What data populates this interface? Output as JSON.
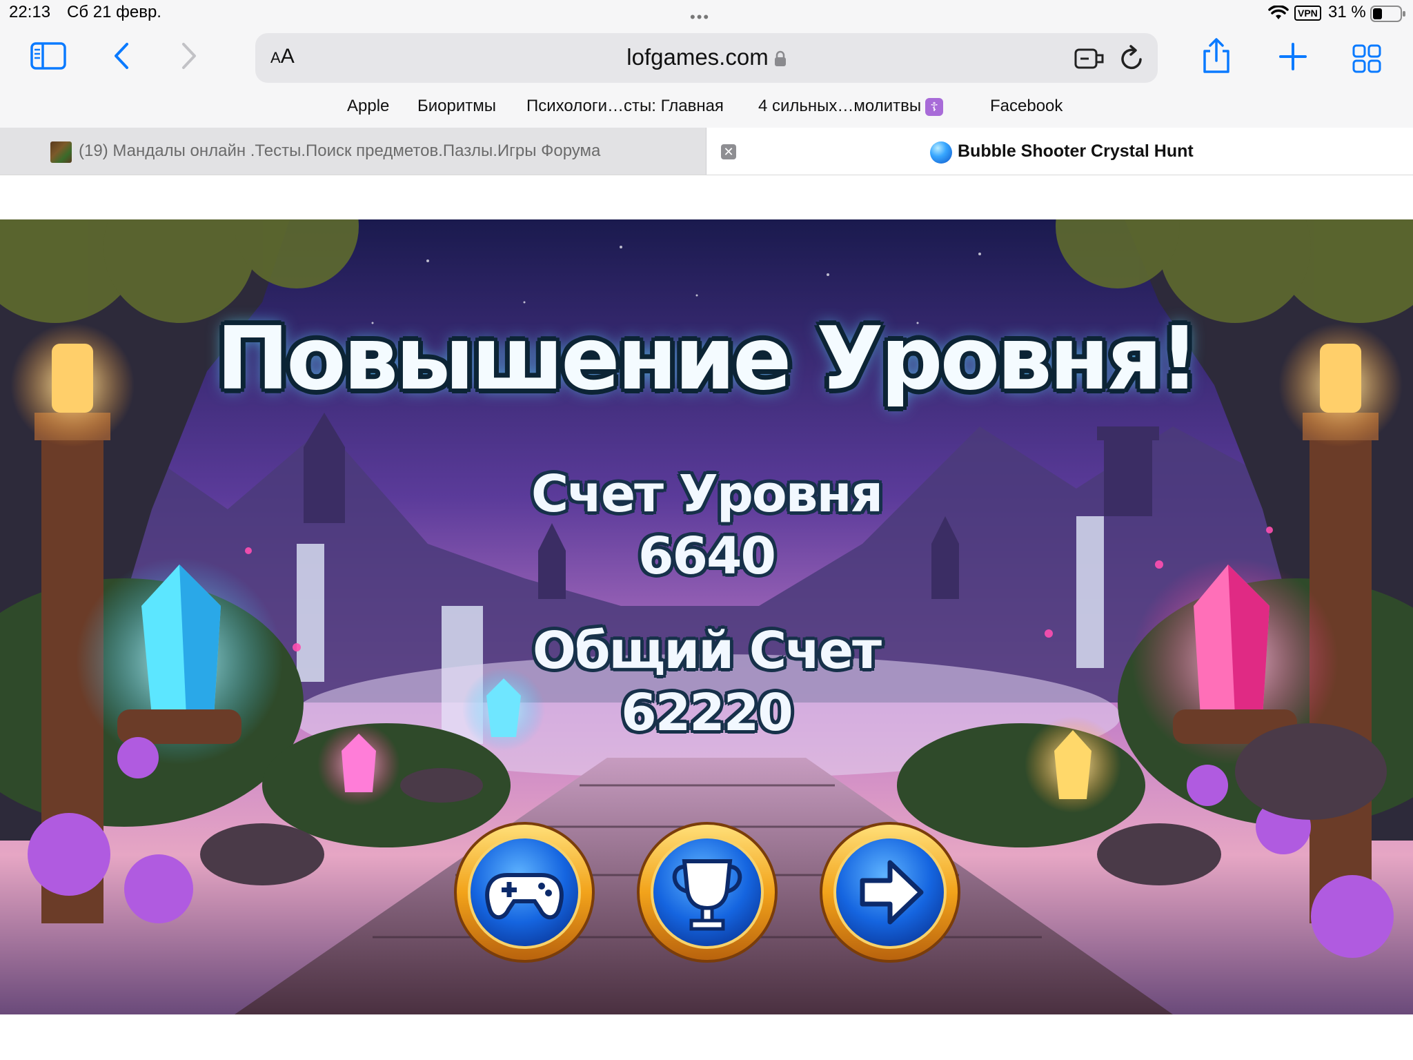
{
  "status_bar": {
    "time": "22:13",
    "date": "Сб 21 февр.",
    "vpn": "VPN",
    "battery": "31 %"
  },
  "toolbar": {
    "reader_label_small": "A",
    "reader_label_large": "A",
    "url": "lofgames.com"
  },
  "bookmarks": [
    {
      "label": "Apple"
    },
    {
      "label": "Биоритмы"
    },
    {
      "label": "Психологи…сты: Главная"
    },
    {
      "label": "4 сильных…молитвы"
    },
    {
      "label": "Facebook"
    }
  ],
  "tabs": {
    "inactive_title": "(19) Мандалы онлайн .Тесты.Поиск предметов.Пазлы.Игры Форума",
    "close_glyph": "✕",
    "active_title": "Bubble Shooter Crystal Hunt"
  },
  "game": {
    "title": "Повышение Уровня!",
    "level_score_label": "Счет Уровня",
    "level_score": "6640",
    "total_score_label": "Общий Счет",
    "total_score": "62220",
    "buttons": [
      {
        "icon": "gamepad-icon"
      },
      {
        "icon": "trophy-icon"
      },
      {
        "icon": "arrow-right-icon"
      }
    ]
  },
  "colors": {
    "accent_blue": "#007aff",
    "button_gold": "#f2a31b",
    "button_blue": "#1565e0"
  }
}
